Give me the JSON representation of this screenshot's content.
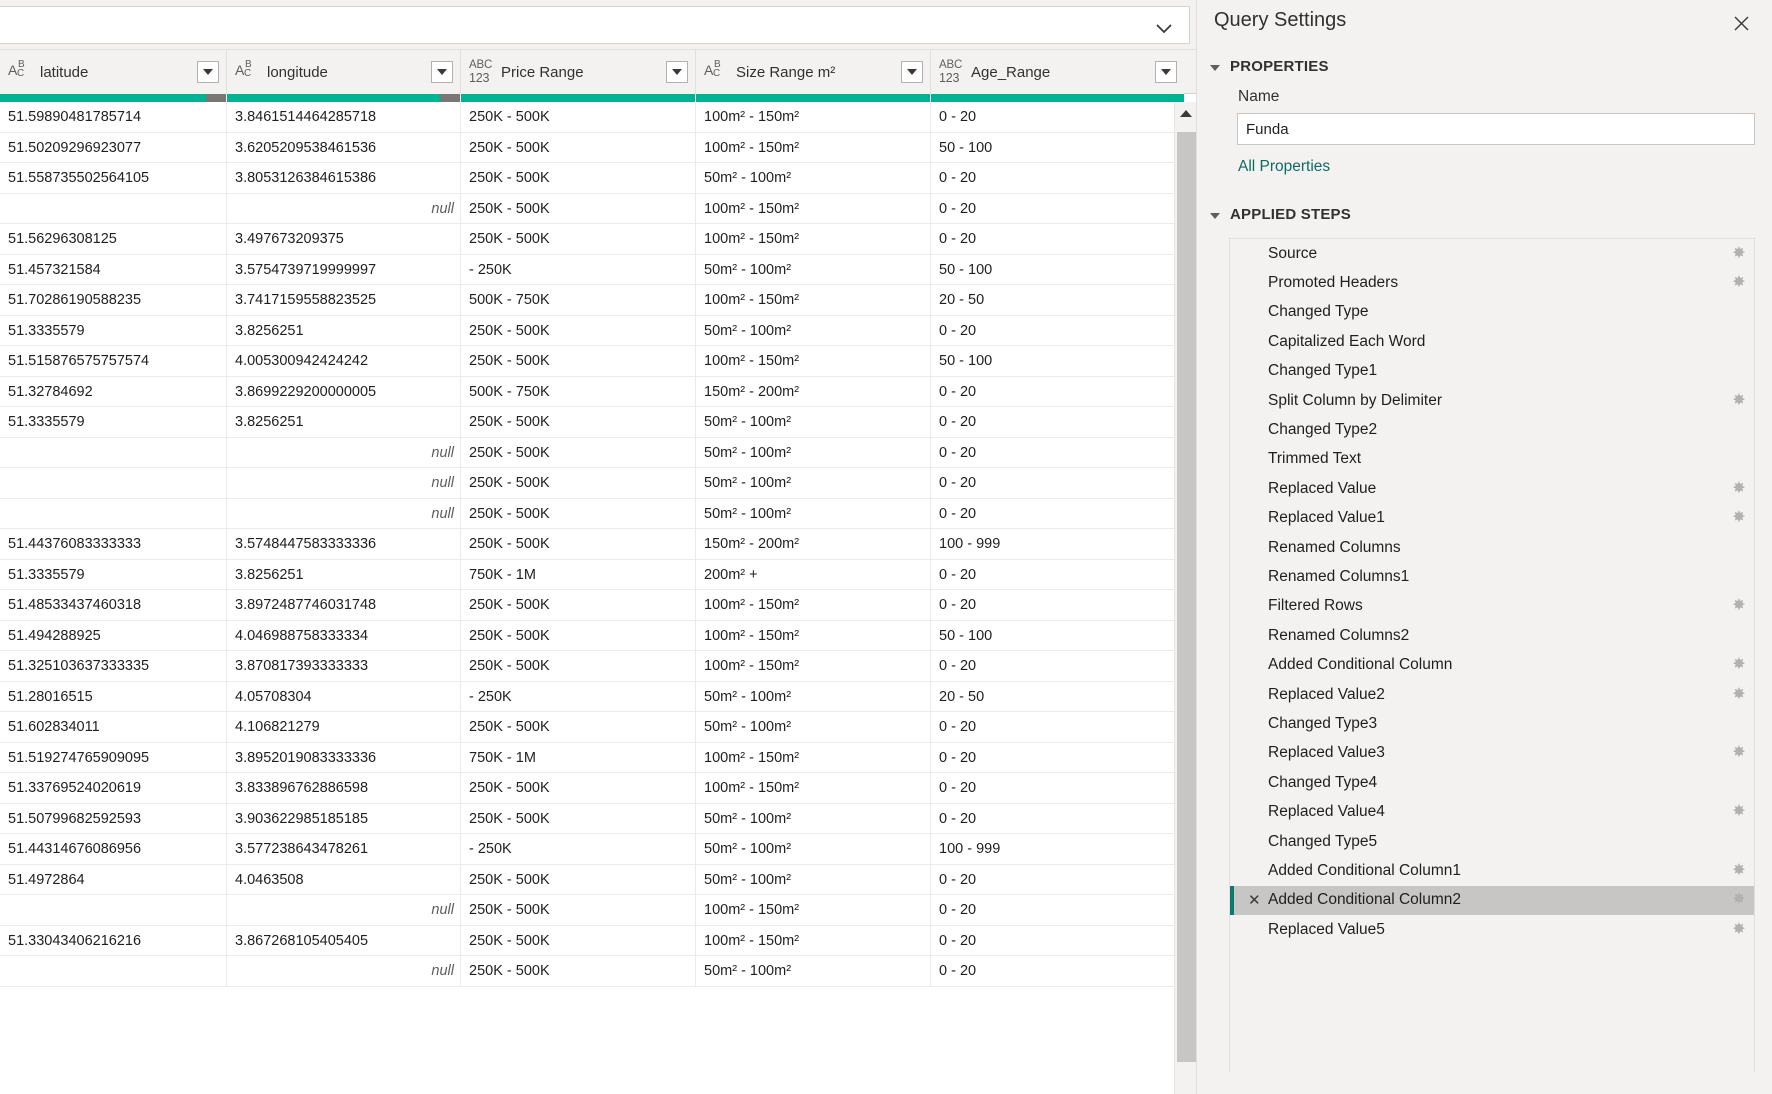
{
  "formula_bar": {
    "value": "",
    "expand_icon": "chevron-down-icon"
  },
  "grid": {
    "columns": [
      {
        "name": "latitude",
        "type_icon": "text-type-icon",
        "type_glyph": "ABC"
      },
      {
        "name": "longitude",
        "type_icon": "text-type-icon",
        "type_glyph": "ABC"
      },
      {
        "name": "Price Range",
        "type_icon": "any-type-icon",
        "type_glyph": "ABC123"
      },
      {
        "name": "Size Range m²",
        "type_icon": "text-type-icon",
        "type_glyph": "ABC"
      },
      {
        "name": "Age_Range",
        "type_icon": "any-type-icon",
        "type_glyph": "ABC123"
      }
    ],
    "quality_color": "#00b294",
    "quality_error_color": "#797775",
    "null_label": "null",
    "rows": [
      [
        "51.59890481785714",
        "3.8461514464285718",
        "250K - 500K",
        "100m² - 150m²",
        "0 - 20"
      ],
      [
        "51.50209296923077",
        "3.6205209538461536",
        "250K - 500K",
        "100m² - 150m²",
        "50 - 100"
      ],
      [
        "51.558735502564105",
        "3.8053126384615386",
        "250K - 500K",
        "50m² - 100m²",
        "0 - 20"
      ],
      [
        "",
        "null",
        "250K - 500K",
        "100m² - 150m²",
        "0 - 20"
      ],
      [
        "51.56296308125",
        "3.497673209375",
        "250K - 500K",
        "100m² - 150m²",
        "0 - 20"
      ],
      [
        "51.457321584",
        "3.5754739719999997",
        "- 250K",
        "50m² - 100m²",
        "50 - 100"
      ],
      [
        "51.70286190588235",
        "3.7417159558823525",
        "500K - 750K",
        "100m² - 150m²",
        "20 - 50"
      ],
      [
        "51.3335579",
        "3.8256251",
        "250K - 500K",
        "50m² - 100m²",
        "0 - 20"
      ],
      [
        "51.515876575757574",
        "4.005300942424242",
        "250K - 500K",
        "100m² - 150m²",
        "50 - 100"
      ],
      [
        "51.32784692",
        "3.8699229200000005",
        "500K - 750K",
        "150m² - 200m²",
        "0 - 20"
      ],
      [
        "51.3335579",
        "3.8256251",
        "250K - 500K",
        "50m² - 100m²",
        "0 - 20"
      ],
      [
        "",
        "null",
        "250K - 500K",
        "50m² - 100m²",
        "0 - 20"
      ],
      [
        "",
        "null",
        "250K - 500K",
        "50m² - 100m²",
        "0 - 20"
      ],
      [
        "",
        "null",
        "250K - 500K",
        "50m² - 100m²",
        "0 - 20"
      ],
      [
        "51.44376083333333",
        "3.5748447583333336",
        "250K - 500K",
        "150m² - 200m²",
        "100 - 999"
      ],
      [
        "51.3335579",
        "3.8256251",
        "750K - 1M",
        "200m² +",
        "0 - 20"
      ],
      [
        "51.48533437460318",
        "3.8972487746031748",
        "250K - 500K",
        "100m² - 150m²",
        "0 - 20"
      ],
      [
        "51.494288925",
        "4.046988758333334",
        "250K - 500K",
        "100m² - 150m²",
        "50 - 100"
      ],
      [
        "51.325103637333335",
        "3.870817393333333",
        "250K - 500K",
        "100m² - 150m²",
        "0 - 20"
      ],
      [
        "51.28016515",
        "4.05708304",
        "- 250K",
        "50m² - 100m²",
        "20 - 50"
      ],
      [
        "51.602834011",
        "4.106821279",
        "250K - 500K",
        "50m² - 100m²",
        "0 - 20"
      ],
      [
        "51.519274765909095",
        "3.8952019083333336",
        "750K - 1M",
        "100m² - 150m²",
        "0 - 20"
      ],
      [
        "51.33769524020619",
        "3.833896762886598",
        "250K - 500K",
        "100m² - 150m²",
        "0 - 20"
      ],
      [
        "51.50799682592593",
        "3.903622985185185",
        "250K - 500K",
        "50m² - 100m²",
        "0 - 20"
      ],
      [
        "51.44314676086956",
        "3.577238643478261",
        "- 250K",
        "50m² - 100m²",
        "100 - 999"
      ],
      [
        "51.4972864",
        "4.0463508",
        "250K - 500K",
        "50m² - 100m²",
        "0 - 20"
      ],
      [
        "",
        "null",
        "250K - 500K",
        "100m² - 150m²",
        "0 - 20"
      ],
      [
        "51.33043406216216",
        "3.867268105405405",
        "250K - 500K",
        "100m² - 150m²",
        "0 - 20"
      ],
      [
        "",
        "null",
        "250K - 500K",
        "50m² - 100m²",
        "0 - 20"
      ]
    ]
  },
  "query_settings": {
    "title": "Query Settings",
    "close_icon": "close-icon",
    "properties": {
      "section_label": "PROPERTIES",
      "name_label": "Name",
      "name_value": "Funda",
      "name_placeholder": "",
      "all_properties_link": "All Properties"
    },
    "applied_steps": {
      "section_label": "APPLIED STEPS",
      "selected_index": 22,
      "delete_icon": "close-icon",
      "gear_icon": "gear-icon",
      "accent_color": "#0b7a6c",
      "steps": [
        {
          "label": "Source",
          "gear": true
        },
        {
          "label": "Promoted Headers",
          "gear": true
        },
        {
          "label": "Changed Type",
          "gear": false
        },
        {
          "label": "Capitalized Each Word",
          "gear": false
        },
        {
          "label": "Changed Type1",
          "gear": false
        },
        {
          "label": "Split Column by Delimiter",
          "gear": true
        },
        {
          "label": "Changed Type2",
          "gear": false
        },
        {
          "label": "Trimmed Text",
          "gear": false
        },
        {
          "label": "Replaced Value",
          "gear": true
        },
        {
          "label": "Replaced Value1",
          "gear": true
        },
        {
          "label": "Renamed Columns",
          "gear": false
        },
        {
          "label": "Renamed Columns1",
          "gear": false
        },
        {
          "label": "Filtered Rows",
          "gear": true
        },
        {
          "label": "Renamed Columns2",
          "gear": false
        },
        {
          "label": "Added Conditional Column",
          "gear": true
        },
        {
          "label": "Replaced Value2",
          "gear": true
        },
        {
          "label": "Changed Type3",
          "gear": false
        },
        {
          "label": "Replaced Value3",
          "gear": true
        },
        {
          "label": "Changed Type4",
          "gear": false
        },
        {
          "label": "Replaced Value4",
          "gear": true
        },
        {
          "label": "Changed Type5",
          "gear": false
        },
        {
          "label": "Added Conditional Column1",
          "gear": true
        },
        {
          "label": "Added Conditional Column2",
          "gear": true
        },
        {
          "label": "Replaced Value5",
          "gear": true
        }
      ]
    }
  }
}
